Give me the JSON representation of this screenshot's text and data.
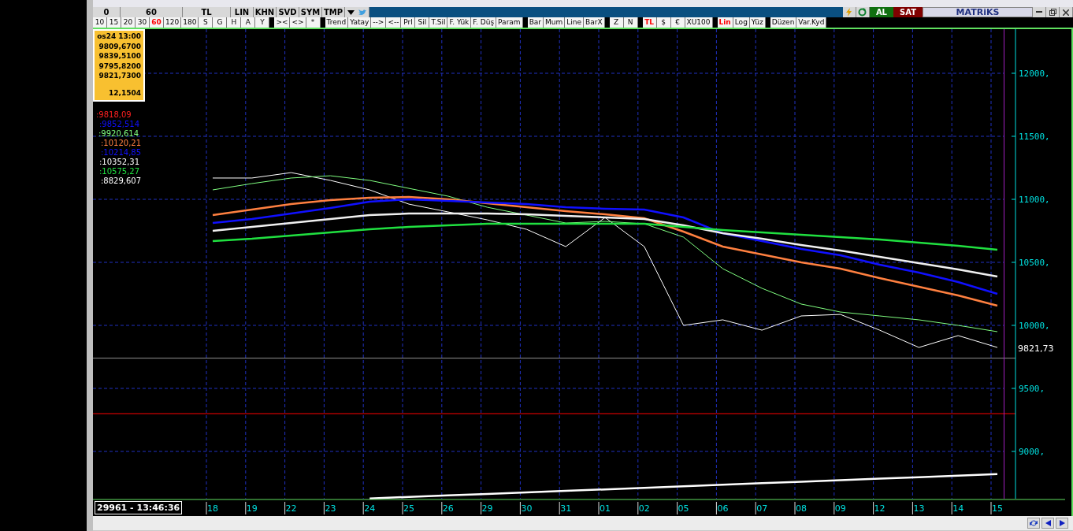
{
  "toolbar_top": {
    "cells": [
      {
        "label": "0"
      },
      {
        "label": "60"
      },
      {
        "label": "TL"
      },
      {
        "label": "LIN"
      },
      {
        "label": "KHN"
      },
      {
        "label": "SVD"
      },
      {
        "label": "SYM"
      },
      {
        "label": "TMP"
      }
    ],
    "buy": "AL",
    "sell": "SAT",
    "brand": "MATRiKS"
  },
  "toolbar_buttons": [
    {
      "kind": "button",
      "label": "10",
      "selected": false
    },
    {
      "kind": "button",
      "label": "15",
      "selected": false
    },
    {
      "kind": "button",
      "label": "20",
      "selected": false
    },
    {
      "kind": "button",
      "label": "30",
      "selected": false
    },
    {
      "kind": "button",
      "label": "60",
      "selected": true
    },
    {
      "kind": "button",
      "label": "120",
      "selected": false
    },
    {
      "kind": "button",
      "label": "180",
      "selected": false
    },
    {
      "kind": "button",
      "label": "S",
      "selected": false
    },
    {
      "kind": "button",
      "label": "G",
      "selected": false
    },
    {
      "kind": "button",
      "label": "H",
      "selected": false
    },
    {
      "kind": "button",
      "label": "A",
      "selected": false
    },
    {
      "kind": "button",
      "label": "Y",
      "selected": false
    },
    {
      "kind": "sep"
    },
    {
      "kind": "button",
      "label": "><",
      "selected": false
    },
    {
      "kind": "button",
      "label": "<>",
      "selected": false
    },
    {
      "kind": "button",
      "label": "*",
      "selected": false
    },
    {
      "kind": "sep"
    },
    {
      "kind": "button",
      "label": "Trend",
      "selected": false
    },
    {
      "kind": "button",
      "label": "Yatay",
      "selected": false
    },
    {
      "kind": "button",
      "label": "-->",
      "selected": false
    },
    {
      "kind": "button",
      "label": "<--",
      "selected": false
    },
    {
      "kind": "button",
      "label": "Prl",
      "selected": false
    },
    {
      "kind": "button",
      "label": "Sil",
      "selected": false
    },
    {
      "kind": "button",
      "label": "T.Sil",
      "selected": false
    },
    {
      "kind": "button",
      "label": "F. Yük",
      "selected": false
    },
    {
      "kind": "button",
      "label": "F. Düş",
      "selected": false
    },
    {
      "kind": "button",
      "label": "Param",
      "selected": false
    },
    {
      "kind": "sep"
    },
    {
      "kind": "button",
      "label": "Bar",
      "selected": false
    },
    {
      "kind": "button",
      "label": "Mum",
      "selected": false
    },
    {
      "kind": "button",
      "label": "Line",
      "selected": false
    },
    {
      "kind": "button",
      "label": "BarX",
      "selected": false
    },
    {
      "kind": "sep"
    },
    {
      "kind": "button",
      "label": "Z",
      "selected": false
    },
    {
      "kind": "button",
      "label": "N",
      "selected": false
    },
    {
      "kind": "sep"
    },
    {
      "kind": "button",
      "label": "TL",
      "selected": true
    },
    {
      "kind": "button",
      "label": "$",
      "selected": false
    },
    {
      "kind": "button",
      "label": "€",
      "selected": false
    },
    {
      "kind": "button",
      "label": "XU100",
      "selected": false
    },
    {
      "kind": "sep"
    },
    {
      "kind": "button",
      "label": "Lin",
      "selected": true
    },
    {
      "kind": "button",
      "label": "Log",
      "selected": false
    },
    {
      "kind": "button",
      "label": "Yüz",
      "selected": false
    },
    {
      "kind": "sep"
    },
    {
      "kind": "button",
      "label": "Düzen",
      "selected": false
    },
    {
      "kind": "button",
      "label": "Var.Kyd",
      "selected": false
    }
  ],
  "info_box": {
    "lines": [
      "os24 13:00",
      "9809,6700",
      "9839,5100",
      "9795,8200",
      "9821,7300"
    ],
    "footer": "12,1504"
  },
  "legend": [
    {
      "value": ":9818,09",
      "color": "#ff2020"
    },
    {
      "value": ":9852,514",
      "color": "#1010ff"
    },
    {
      "value": ":9920,614",
      "color": "#80ff80"
    },
    {
      "value": ":10120,21",
      "color": "#ff8040"
    },
    {
      "value": ":10214,85",
      "color": "#1010ff"
    },
    {
      "value": ":10352,31",
      "color": "#ffffff"
    },
    {
      "value": ":10575,27",
      "color": "#20e040"
    },
    {
      "value": ":8829,607",
      "color": "#ffffff"
    }
  ],
  "price_label": "9821,73",
  "chart_data": {
    "type": "line",
    "categories": [
      "18",
      "19",
      "22",
      "23",
      "24",
      "25",
      "26",
      "29",
      "30",
      "31",
      "01",
      "02",
      "05",
      "06",
      "07",
      "08",
      "09",
      "12",
      "13",
      "14",
      "15"
    ],
    "ylim": [
      8625,
      12350
    ],
    "grid": true,
    "yticks": [
      {
        "value": 9000,
        "label": "9000,"
      },
      {
        "value": 9500,
        "label": "9500,"
      },
      {
        "value": 10000,
        "label": "10000,"
      },
      {
        "value": 10500,
        "label": "10500,"
      },
      {
        "value": 11000,
        "label": "11000,"
      },
      {
        "value": 11500,
        "label": "11500,"
      },
      {
        "value": 12000,
        "label": "12000,"
      }
    ],
    "series": [
      {
        "color": "#ffffff",
        "values": [
          11169,
          11169,
          11212,
          11150,
          11075,
          10962,
          10900,
          10837,
          10762,
          10625,
          10856,
          10625,
          10000,
          10044,
          9962,
          10075,
          10087,
          9962,
          9825,
          9919,
          9825
        ]
      },
      {
        "color": "#80ff80",
        "values": [
          11075,
          11125,
          11169,
          11187,
          11150,
          11087,
          11025,
          10937,
          10875,
          10812,
          10825,
          10806,
          10700,
          10450,
          10294,
          10169,
          10106,
          10075,
          10044,
          10000,
          9950
        ]
      },
      {
        "color": "#ff8040",
        "values": [
          10875,
          10919,
          10962,
          10994,
          11012,
          11019,
          11000,
          10969,
          10937,
          10906,
          10881,
          10850,
          10744,
          10625,
          10562,
          10500,
          10450,
          10375,
          10306,
          10237,
          10156
        ]
      },
      {
        "color": "#1010ff",
        "values": [
          10812,
          10844,
          10887,
          10931,
          10981,
          11000,
          10987,
          10975,
          10962,
          10937,
          10925,
          10919,
          10856,
          10731,
          10669,
          10606,
          10556,
          10481,
          10419,
          10344,
          10250
        ]
      },
      {
        "color": "#f0f0f0",
        "values": [
          10750,
          10781,
          10812,
          10844,
          10875,
          10887,
          10887,
          10887,
          10881,
          10869,
          10856,
          10844,
          10794,
          10731,
          10687,
          10637,
          10594,
          10544,
          10494,
          10444,
          10387
        ]
      },
      {
        "color": "#20e040",
        "values": [
          10669,
          10687,
          10712,
          10737,
          10762,
          10781,
          10794,
          10806,
          10806,
          10806,
          10806,
          10806,
          10781,
          10756,
          10737,
          10719,
          10700,
          10681,
          10656,
          10631,
          10600
        ]
      },
      {
        "color": "#ffffff",
        "values": [
          null,
          null,
          null,
          null,
          8627,
          8639,
          8651,
          8663,
          8675,
          8687,
          8699,
          8711,
          8724,
          8736,
          8748,
          8760,
          8772,
          8784,
          8796,
          8808,
          8820
        ]
      }
    ],
    "ref_lines": [
      {
        "axis": "y",
        "value": 9300,
        "color": "#ff0000"
      },
      {
        "axis": "y",
        "value": 9740,
        "color": "#909090"
      }
    ]
  },
  "time_box": "29961 - 13:46:36"
}
